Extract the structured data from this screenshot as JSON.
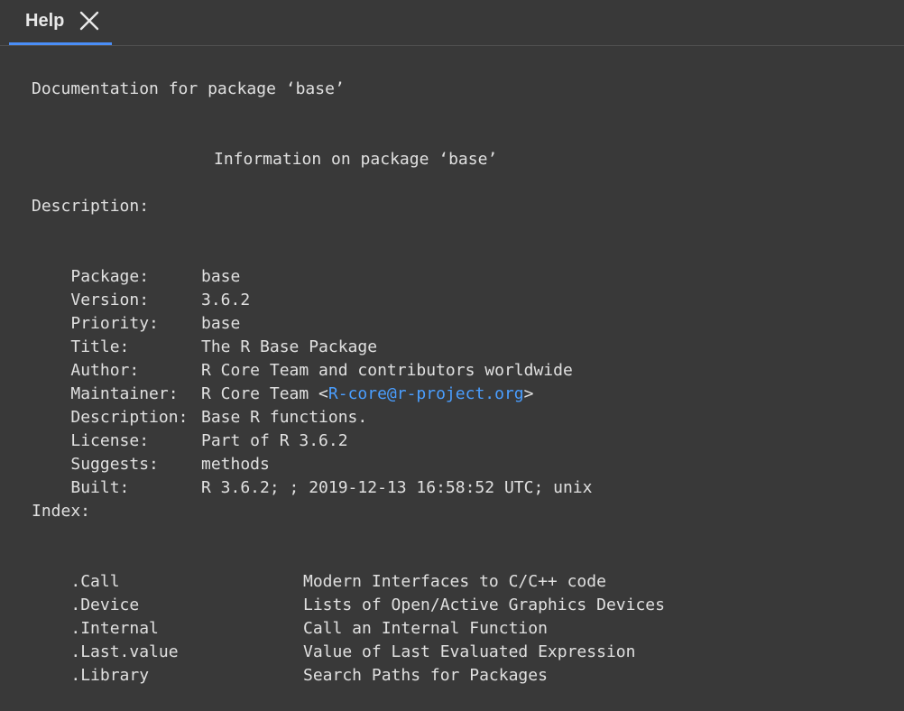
{
  "tab": {
    "label": "Help",
    "close_icon": "close-icon"
  },
  "doc": {
    "heading": "Documentation for package ‘base’",
    "subheading": "Information on package ‘base’",
    "description_header": "Description:",
    "fields": [
      {
        "key": "Package:",
        "value": "base"
      },
      {
        "key": "Version:",
        "value": "3.6.2"
      },
      {
        "key": "Priority:",
        "value": "base"
      },
      {
        "key": "Title:",
        "value": "The R Base Package"
      },
      {
        "key": "Author:",
        "value": "R Core Team and contributors worldwide"
      },
      {
        "key": "Maintainer:",
        "value_prefix": "R Core Team <",
        "value_link": "R-core@r-project.org",
        "value_suffix": ">"
      },
      {
        "key": "Description:",
        "value": "Base R functions."
      },
      {
        "key": "License:",
        "value": "Part of R 3.6.2"
      },
      {
        "key": "Suggests:",
        "value": "methods"
      },
      {
        "key": "Built:",
        "value": "R 3.6.2; ; 2019-12-13 16:58:52 UTC; unix"
      }
    ],
    "index_header": "Index:",
    "index": [
      {
        "name": ".Call",
        "desc": "Modern Interfaces to C/C++ code"
      },
      {
        "name": ".Device",
        "desc": "Lists of Open/Active Graphics Devices"
      },
      {
        "name": ".Internal",
        "desc": "Call an Internal Function"
      },
      {
        "name": ".Last.value",
        "desc": "Value of Last Evaluated Expression"
      },
      {
        "name": ".Library",
        "desc": "Search Paths for Packages"
      }
    ]
  },
  "colors": {
    "background": "#393939",
    "text": "#e0e0e0",
    "link": "#4a9eff",
    "tab_indicator": "#4a8ef7"
  }
}
